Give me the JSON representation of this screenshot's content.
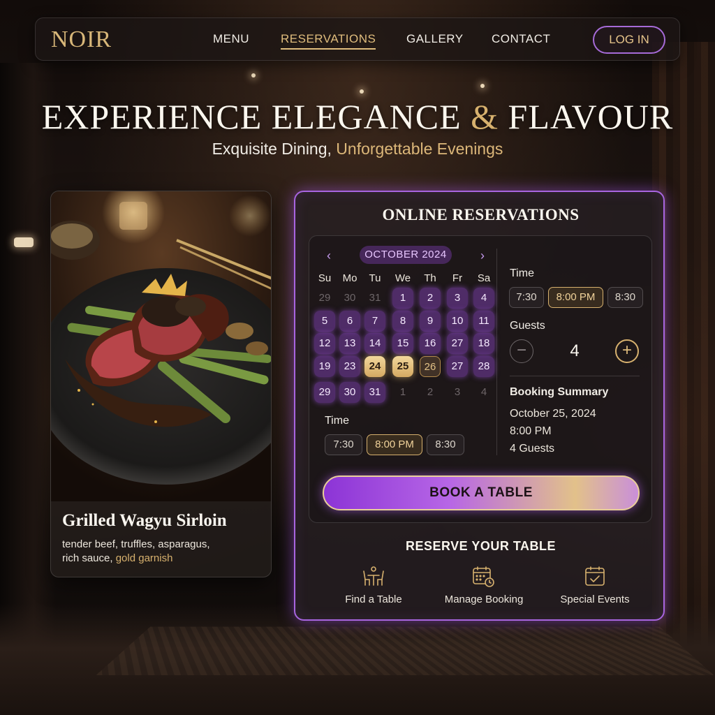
{
  "brand": {
    "logo": "NOIR"
  },
  "nav": {
    "links": [
      "MENU",
      "RESERVATIONS",
      "GALLERY",
      "CONTACT"
    ],
    "active": "RESERVATIONS",
    "login": "LOG IN"
  },
  "hero": {
    "title_part1": "EXPERIENCE ELEGANCE",
    "title_amp": "&",
    "title_part2": "FLAVOUR",
    "sub_part1": "Exquisite Dining,",
    "sub_part2": "Unforgettable Evenings"
  },
  "dish": {
    "name": "Grilled Wagyu Sirloin",
    "desc_line1": "tender beef, truffles, asparagus,",
    "desc_line2a": "rich sauce,",
    "desc_line2b": "gold garnish"
  },
  "reservation": {
    "title": "ONLINE RESERVATIONS",
    "calendar": {
      "month": "OCTOBER 2024",
      "prev_icon": "chevron-left-icon",
      "next_icon": "chevron-right-icon",
      "weekdays": [
        "Su",
        "Mo",
        "Tu",
        "We",
        "Th",
        "Fr",
        "Sa"
      ],
      "weeks": [
        [
          "29",
          "30",
          "31",
          "1",
          "2",
          "3",
          "4"
        ],
        [
          "5",
          "6",
          "7",
          "8",
          "9",
          "10",
          "11"
        ],
        [
          "12",
          "13",
          "14",
          "15",
          "16",
          "27",
          "18"
        ],
        [
          "19",
          "23",
          "24",
          "25",
          "26",
          "27",
          "28"
        ],
        [
          "29",
          "30",
          "31",
          "1",
          "2",
          "3",
          "4"
        ]
      ],
      "selected": [
        "24",
        "25"
      ],
      "highlighted": "26"
    },
    "time_left": {
      "label": "Time",
      "options": [
        "7:30",
        "8:00 PM",
        "8:30"
      ],
      "selected": "8:00 PM"
    },
    "time_right": {
      "label": "Time",
      "options": [
        "7:30",
        "8:00 PM",
        "8:30"
      ],
      "selected": "8:00 PM"
    },
    "guests": {
      "label": "Guests",
      "count": "4",
      "minus": "−",
      "plus": "+"
    },
    "summary": {
      "title": "Booking Summary",
      "date": "October 25, 2024",
      "time": "8:00 PM",
      "guests": "4 Guests"
    },
    "book_button": "BOOK A TABLE",
    "reserve_title": "RESERVE YOUR TABLE",
    "features": [
      {
        "label": "Find a Table",
        "icon": "dining-table-icon"
      },
      {
        "label": "Manage Booking",
        "icon": "calendar-clock-icon"
      },
      {
        "label": "Special Events",
        "icon": "calendar-check-icon"
      }
    ]
  },
  "colors": {
    "gold": "#d7b16e",
    "purple": "#a865e0",
    "background": "#15100e"
  }
}
